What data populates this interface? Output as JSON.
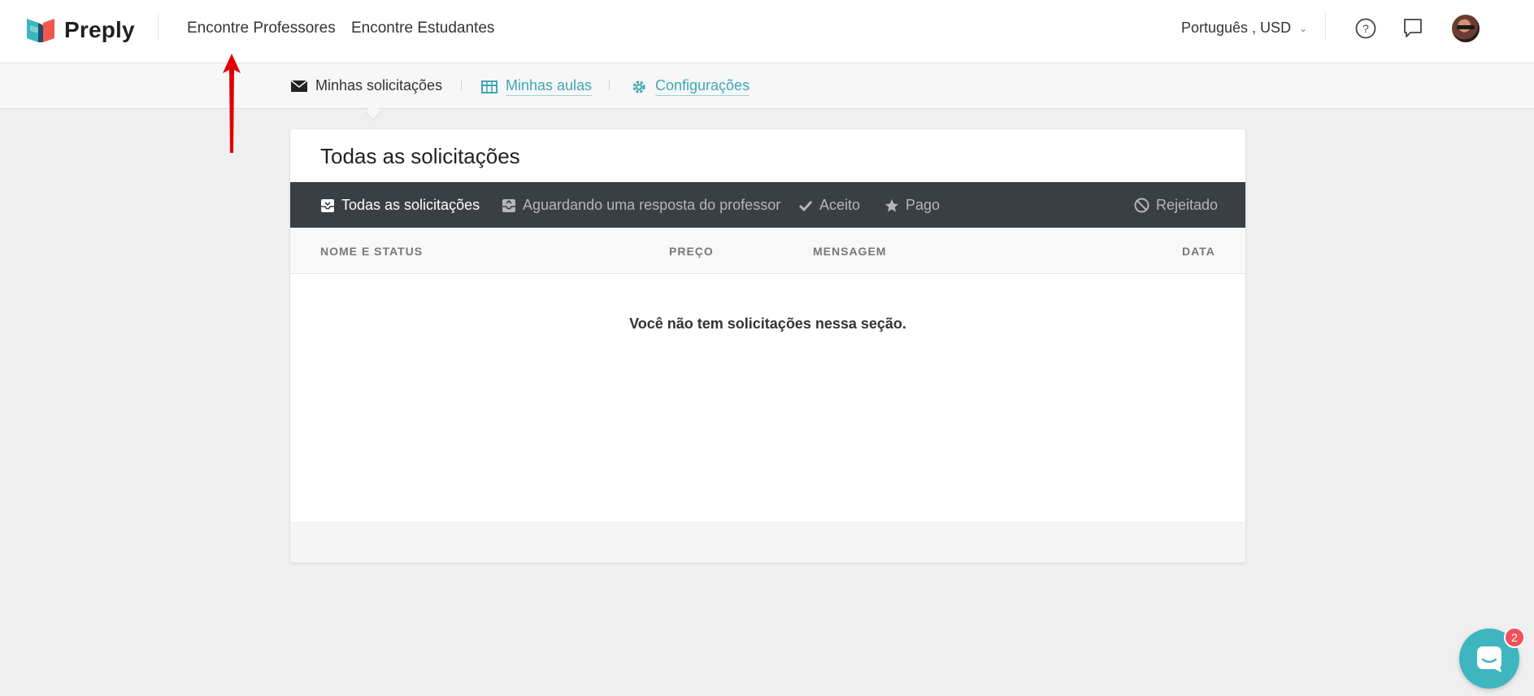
{
  "app": {
    "logo_text": "Preply"
  },
  "header": {
    "nav": [
      {
        "label": "Encontre Professores"
      },
      {
        "label": "Encontre Estudantes"
      }
    ],
    "language_currency": "Português , USD"
  },
  "subnav": {
    "items": [
      {
        "label": "Minhas solicitações",
        "icon": "envelope-icon",
        "active": true
      },
      {
        "label": "Minhas aulas",
        "icon": "calendar-icon",
        "active": false
      },
      {
        "label": "Configurações",
        "icon": "gear-icon",
        "active": false
      }
    ]
  },
  "card": {
    "title": "Todas as solicitações",
    "filters": [
      {
        "label": "Todas as solicitações",
        "icon": "inbox-icon",
        "active": true
      },
      {
        "label": "Aguardando uma resposta do professor",
        "icon": "inbox-pending-icon",
        "active": false
      },
      {
        "label": "Aceito",
        "icon": "check-icon",
        "active": false
      },
      {
        "label": "Pago",
        "icon": "star-icon",
        "active": false
      },
      {
        "label": "Rejeitado",
        "icon": "block-icon",
        "active": false
      }
    ],
    "columns": [
      "NOME E STATUS",
      "PREÇO",
      "MENSAGEM",
      "DATA"
    ],
    "empty_message": "Você não tem solicitações nessa seção."
  },
  "chat": {
    "badge_count": "2"
  },
  "colors": {
    "accent": "#3ea7b5",
    "filter_bar": "#3a3f45",
    "arrow": "#e00000",
    "chat": "#3fb6bf",
    "badge": "#f0515a"
  }
}
